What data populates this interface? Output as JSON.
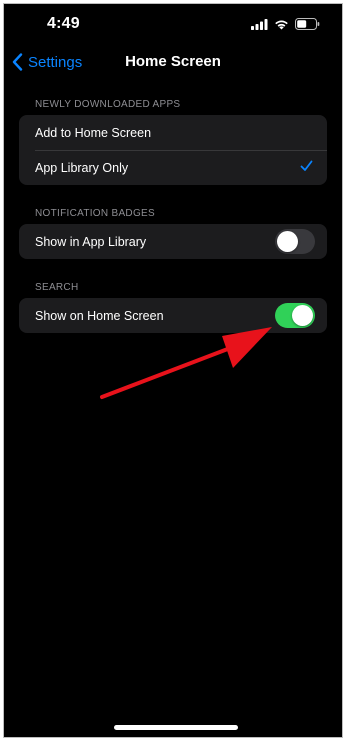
{
  "status_bar": {
    "time": "4:49"
  },
  "nav": {
    "back_label": "Settings",
    "title": "Home Screen"
  },
  "sections": [
    {
      "header": "NEWLY DOWNLOADED APPS",
      "rows": [
        {
          "label": "Add to Home Screen",
          "checked": false
        },
        {
          "label": "App Library Only",
          "checked": true
        }
      ]
    },
    {
      "header": "NOTIFICATION BADGES",
      "rows": [
        {
          "label": "Show in App Library",
          "toggle_on": false
        }
      ]
    },
    {
      "header": "SEARCH",
      "rows": [
        {
          "label": "Show on Home Screen",
          "toggle_on": true
        }
      ]
    }
  ],
  "colors": {
    "background": "#000000",
    "cell": "#1c1c1e",
    "accent": "#0a84ff",
    "toggle_on": "#30d158",
    "annotation_arrow": "#e8121b"
  },
  "icons": [
    "cellular-signal-icon",
    "wifi-icon",
    "battery-icon",
    "chevron-left-icon",
    "checkmark-icon",
    "annotation-arrow"
  ]
}
